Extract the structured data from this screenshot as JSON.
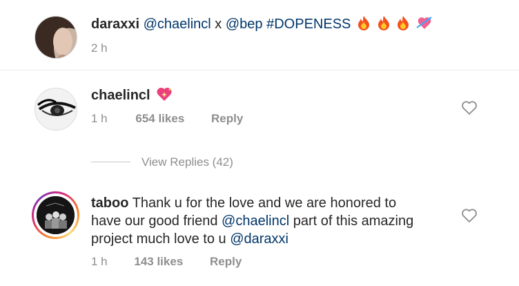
{
  "comments": [
    {
      "username": "daraxxi",
      "text_mention_1": "@chaelincl",
      "text_x": " x ",
      "text_mention_2": "@bep",
      "text_hashtag": " #DOPENESS",
      "time": "2 h",
      "emojis": [
        "fire-emoji",
        "fire-emoji",
        "fire-emoji",
        "heart-with-arrow-emoji"
      ]
    },
    {
      "username": "chaelincl",
      "time": "1 h",
      "likes": "654 likes",
      "reply": "Reply",
      "emojis": [
        "sparkling-heart-emoji"
      ],
      "view_replies": "View Replies (42)"
    },
    {
      "username": "taboo",
      "line1": " Thank u for the love and we are honored to",
      "line2_a": "have our good friend ",
      "line2_mention": "@chaelincl",
      "line2_b": " part of this amazing",
      "line3_a": "project much love to u ",
      "line3_mention": "@daraxxi",
      "time": "1 h",
      "likes": "143 likes",
      "reply": "Reply"
    }
  ],
  "colors": {
    "text": "#262626",
    "meta": "#8e8e8e",
    "mention": "#003569",
    "heart_outline": "#8e8e8e"
  }
}
